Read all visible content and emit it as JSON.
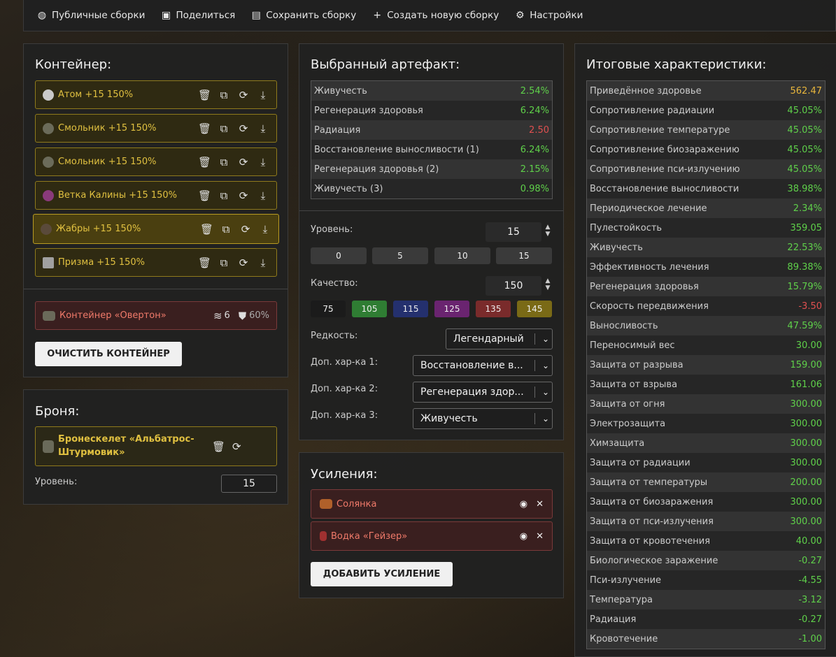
{
  "toolbar": {
    "public": "Публичные сборки",
    "share": "Поделиться",
    "save": "Сохранить сборку",
    "create": "Создать новую сборку",
    "settings": "Настройки"
  },
  "container": {
    "title": "Контейнер:",
    "artifacts": [
      {
        "label": "Атом +15 150%"
      },
      {
        "label": "Смольник +15 150%"
      },
      {
        "label": "Смольник +15 150%"
      },
      {
        "label": "Ветка Калины +15 150%"
      },
      {
        "label": "Жабры +15 150%"
      },
      {
        "label": "Призма +15 150%"
      }
    ],
    "box": {
      "label": "Контейнер «Овертон»",
      "slots": "6",
      "protection": "60%"
    },
    "clear_button": "ОЧИСТИТЬ КОНТЕЙНЕР"
  },
  "armor": {
    "title": "Броня:",
    "name": "Бронескелет «Альбатрос-Штурмовик»",
    "level_label": "Уровень:",
    "level": "15"
  },
  "artifact": {
    "title": "Выбранный артефакт:",
    "stats": [
      {
        "name": "Живучесть",
        "value": "2.54%",
        "color": "green"
      },
      {
        "name": "Регенерация здоровья",
        "value": "6.24%",
        "color": "green"
      },
      {
        "name": "Радиация",
        "value": "2.50",
        "color": "red"
      },
      {
        "name": "Восстановление выносливости (1)",
        "value": "6.24%",
        "color": "green"
      },
      {
        "name": "Регенерация здоровья (2)",
        "value": "2.15%",
        "color": "green"
      },
      {
        "name": "Живучесть (3)",
        "value": "0.98%",
        "color": "green"
      }
    ],
    "level_label": "Уровень:",
    "level": "15",
    "level_presets": [
      "0",
      "5",
      "10",
      "15"
    ],
    "quality_label": "Качество:",
    "quality": "150",
    "quality_presets": [
      {
        "label": "75",
        "color": "#1b1b1b"
      },
      {
        "label": "105",
        "color": "#2f7d33"
      },
      {
        "label": "115",
        "color": "#24306e"
      },
      {
        "label": "125",
        "color": "#6a2470"
      },
      {
        "label": "135",
        "color": "#7a2b2b"
      },
      {
        "label": "145",
        "color": "#7a6a16"
      }
    ],
    "rarity_label": "Редкость:",
    "rarity": "Легендарный",
    "extra1_label": "Доп. хар-ка 1:",
    "extra1": "Восстановление в...",
    "extra2_label": "Доп. хар-ка 2:",
    "extra2": "Регенерация здор...",
    "extra3_label": "Доп. хар-ка 3:",
    "extra3": "Живучесть"
  },
  "boosts": {
    "title": "Усиления:",
    "items": [
      {
        "label": "Солянка"
      },
      {
        "label": "Водка «Гейзер»"
      }
    ],
    "add_button": "ДОБАВИТЬ УСИЛЕНИЕ"
  },
  "totals": {
    "title": "Итоговые характеристики:",
    "stats": [
      {
        "name": "Приведённое здоровье",
        "value": "562.47",
        "color": "gold"
      },
      {
        "name": "Сопротивление радиации",
        "value": "45.05%",
        "color": "green"
      },
      {
        "name": "Сопротивление температуре",
        "value": "45.05%",
        "color": "green"
      },
      {
        "name": "Сопротивление биозаражению",
        "value": "45.05%",
        "color": "green"
      },
      {
        "name": "Сопротивление пси-излучению",
        "value": "45.05%",
        "color": "green"
      },
      {
        "name": "Восстановление выносливости",
        "value": "38.98%",
        "color": "green"
      },
      {
        "name": "Периодическое лечение",
        "value": "2.34%",
        "color": "green"
      },
      {
        "name": "Пулестойкость",
        "value": "359.05",
        "color": "green"
      },
      {
        "name": "Живучесть",
        "value": "22.53%",
        "color": "green"
      },
      {
        "name": "Эффективность лечения",
        "value": "89.38%",
        "color": "green"
      },
      {
        "name": "Регенерация здоровья",
        "value": "15.79%",
        "color": "green"
      },
      {
        "name": "Скорость передвижения",
        "value": "-3.50",
        "color": "red"
      },
      {
        "name": "Выносливость",
        "value": "47.59%",
        "color": "green"
      },
      {
        "name": "Переносимый вес",
        "value": "30.00",
        "color": "green"
      },
      {
        "name": "Защита от разрыва",
        "value": "159.00",
        "color": "green"
      },
      {
        "name": "Защита от взрыва",
        "value": "161.06",
        "color": "green"
      },
      {
        "name": "Защита от огня",
        "value": "300.00",
        "color": "green"
      },
      {
        "name": "Электрозащита",
        "value": "300.00",
        "color": "green"
      },
      {
        "name": "Химзащита",
        "value": "300.00",
        "color": "green"
      },
      {
        "name": "Защита от радиации",
        "value": "300.00",
        "color": "green"
      },
      {
        "name": "Защита от температуры",
        "value": "200.00",
        "color": "green"
      },
      {
        "name": "Защита от биозаражения",
        "value": "300.00",
        "color": "green"
      },
      {
        "name": "Защита от пси-излучения",
        "value": "300.00",
        "color": "green"
      },
      {
        "name": "Защита от кровотечения",
        "value": "40.00",
        "color": "green"
      },
      {
        "name": "Биологическое заражение",
        "value": "-0.27",
        "color": "green"
      },
      {
        "name": "Пси-излучение",
        "value": "-4.55",
        "color": "green"
      },
      {
        "name": "Температура",
        "value": "-3.12",
        "color": "green"
      },
      {
        "name": "Радиация",
        "value": "-0.27",
        "color": "green"
      },
      {
        "name": "Кровотечение",
        "value": "-1.00",
        "color": "green"
      }
    ]
  }
}
